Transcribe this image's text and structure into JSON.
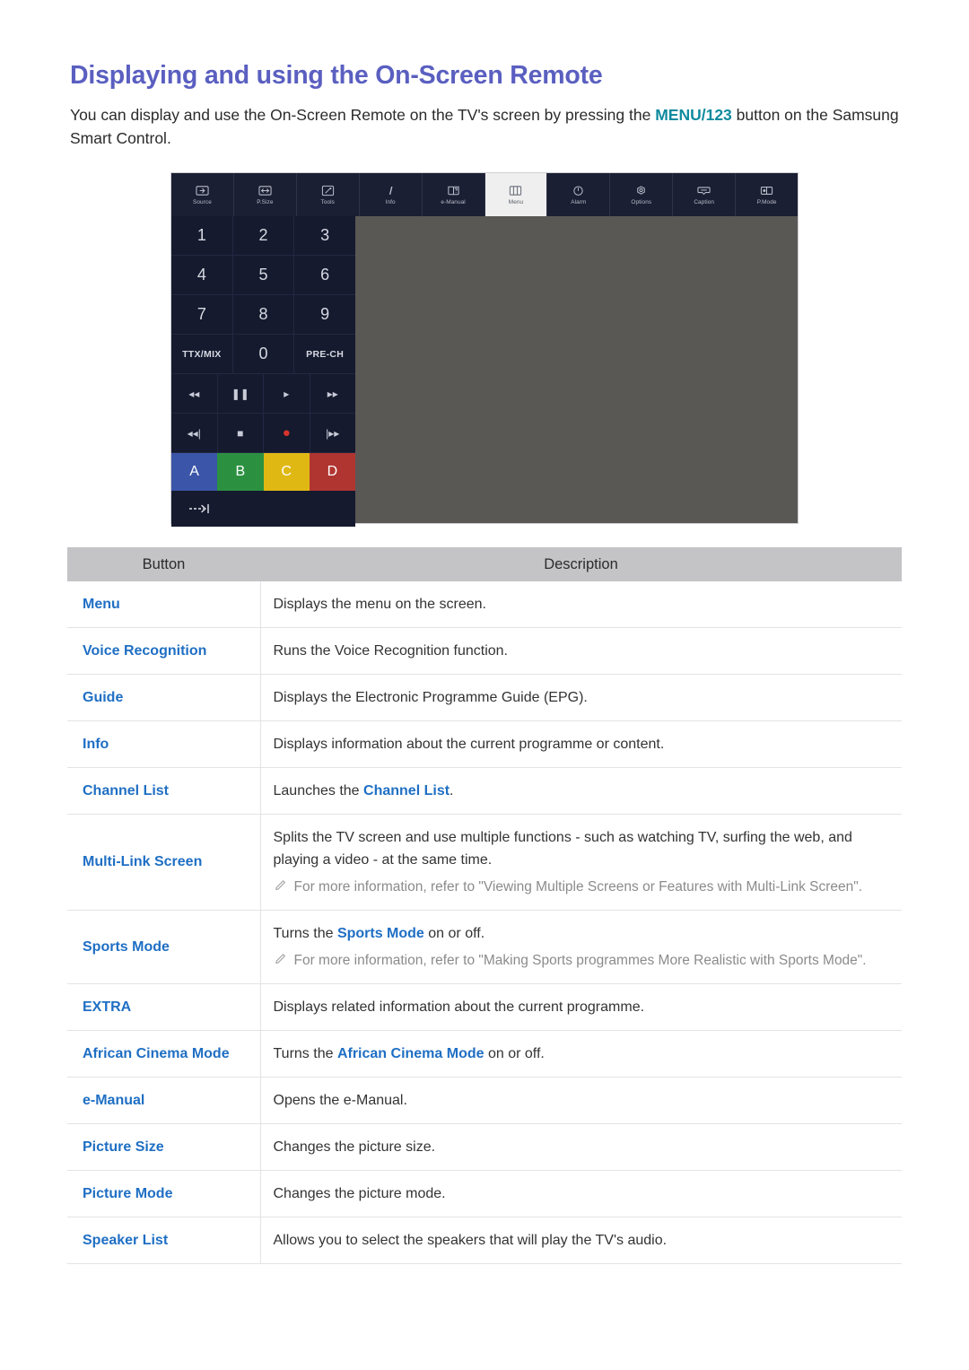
{
  "page": {
    "title": "Displaying and using the On-Screen Remote",
    "intro_before": "You can display and use the On-Screen Remote on the TV's screen by pressing the ",
    "intro_highlight": "MENU/123",
    "intro_after": " button on the Samsung Smart Control."
  },
  "remote": {
    "toolbar": [
      {
        "label": "Source",
        "icon": "source-icon",
        "active": false
      },
      {
        "label": "P.Size",
        "icon": "picture-size-icon",
        "active": false
      },
      {
        "label": "Tools",
        "icon": "tools-icon",
        "active": false
      },
      {
        "label": "Info",
        "icon": "info-icon",
        "active": false
      },
      {
        "label": "e-Manual",
        "icon": "e-manual-icon",
        "active": false
      },
      {
        "label": "Menu",
        "icon": "menu-grid-icon",
        "active": true
      },
      {
        "label": "Alarm",
        "icon": "alarm-icon",
        "active": false
      },
      {
        "label": "Options",
        "icon": "options-gear-icon",
        "active": false
      },
      {
        "label": "Caption",
        "icon": "caption-icon",
        "active": false
      },
      {
        "label": "P.Mode",
        "icon": "picture-mode-icon",
        "active": false
      }
    ],
    "keypad": [
      [
        "1",
        "2",
        "3"
      ],
      [
        "4",
        "5",
        "6"
      ],
      [
        "7",
        "8",
        "9"
      ],
      [
        "TTX/MIX",
        "0",
        "PRE-CH"
      ]
    ],
    "media_row_1": [
      "rewind",
      "pause",
      "play",
      "fast-forward"
    ],
    "media_row_1_glyphs": [
      "◂◂",
      "❚❚",
      "▸",
      "▸▸"
    ],
    "media_row_2": [
      "previous",
      "stop",
      "record",
      "next"
    ],
    "media_row_2_glyphs": [
      "◂◂|",
      "■",
      "●",
      "|▸▸"
    ],
    "color_buttons": [
      {
        "label": "A",
        "color": "#3b55a8"
      },
      {
        "label": "B",
        "color": "#2b9141"
      },
      {
        "label": "C",
        "color": "#e0b814"
      },
      {
        "label": "D",
        "color": "#b03530"
      }
    ],
    "exit_icon": "exit-arrow-icon"
  },
  "table": {
    "headers": {
      "button": "Button",
      "description": "Description"
    },
    "rows": [
      {
        "button": "Menu",
        "desc_parts": [
          {
            "t": "Displays the menu on the screen."
          }
        ]
      },
      {
        "button": "Voice Recognition",
        "desc_parts": [
          {
            "t": "Runs the Voice Recognition function."
          }
        ]
      },
      {
        "button": "Guide",
        "desc_parts": [
          {
            "t": "Displays the Electronic Programme Guide (EPG)."
          }
        ]
      },
      {
        "button": "Info",
        "desc_parts": [
          {
            "t": "Displays information about the current programme or content."
          }
        ]
      },
      {
        "button": "Channel List",
        "desc_parts": [
          {
            "t": "Launches the "
          },
          {
            "t": "Channel List",
            "hl": true
          },
          {
            "t": "."
          }
        ]
      },
      {
        "button": "Multi-Link Screen",
        "desc_parts": [
          {
            "t": "Splits the TV screen and use multiple functions - such as watching TV, surfing the web, and playing a video - at the same time."
          }
        ],
        "note": "For more information, refer to \"Viewing Multiple Screens or Features with Multi-Link Screen\"."
      },
      {
        "button": "Sports Mode",
        "desc_parts": [
          {
            "t": "Turns the "
          },
          {
            "t": "Sports Mode",
            "hl": true
          },
          {
            "t": " on or off."
          }
        ],
        "note": "For more information, refer to \"Making Sports programmes More Realistic with Sports Mode\"."
      },
      {
        "button": "EXTRA",
        "desc_parts": [
          {
            "t": "Displays related information about the current programme."
          }
        ]
      },
      {
        "button": "African Cinema Mode",
        "desc_parts": [
          {
            "t": "Turns the "
          },
          {
            "t": "African Cinema Mode",
            "hl": true
          },
          {
            "t": " on or off."
          }
        ]
      },
      {
        "button": "e-Manual",
        "desc_parts": [
          {
            "t": "Opens the e-Manual."
          }
        ]
      },
      {
        "button": "Picture Size",
        "desc_parts": [
          {
            "t": "Changes the picture size."
          }
        ]
      },
      {
        "button": "Picture Mode",
        "desc_parts": [
          {
            "t": "Changes the picture mode."
          }
        ]
      },
      {
        "button": "Speaker List",
        "desc_parts": [
          {
            "t": "Allows you to select the speakers that will play the TV's audio."
          }
        ]
      }
    ]
  },
  "colors": {
    "title": "#5a5fc0",
    "link": "#1f6fc4",
    "highlight_teal": "#0f8a9e",
    "table_header_bg": "#c4c4c6",
    "remote_bg": "#5a5855",
    "remote_dark": "#151a2e"
  }
}
